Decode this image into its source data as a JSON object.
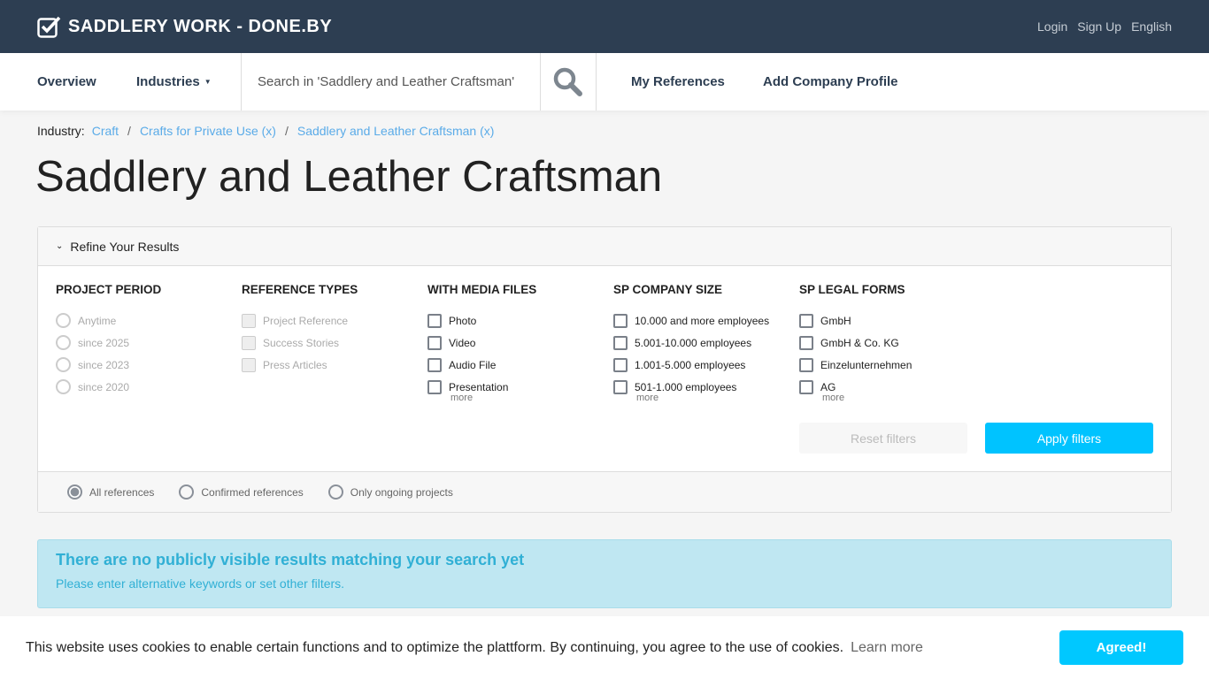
{
  "header": {
    "brand": "SADDLERY WORK - DONE.BY",
    "links": [
      "Login",
      "Sign Up",
      "English"
    ]
  },
  "nav": {
    "overview": "Overview",
    "industries": "Industries",
    "search_placeholder": "Search in 'Saddlery and Leather Craftsman'",
    "my_references": "My References",
    "add_company": "Add Company Profile"
  },
  "breadcrumb": {
    "label": "Industry:",
    "items": [
      "Craft",
      "Crafts for Private Use (x)",
      "Saddlery and Leather Craftsman (x)"
    ]
  },
  "title": "Saddlery and Leather Craftsman",
  "filters": {
    "toggle": "Refine Your Results",
    "columns": [
      {
        "title": "PROJECT PERIOD",
        "type": "radio",
        "disabled": true,
        "items": [
          "Anytime",
          "since 2025",
          "since 2023",
          "since 2020"
        ]
      },
      {
        "title": "REFERENCE TYPES",
        "type": "check",
        "disabled": true,
        "items": [
          "Project Reference",
          "Success Stories",
          "Press Articles"
        ]
      },
      {
        "title": "WITH MEDIA FILES",
        "type": "check",
        "items": [
          "Photo",
          "Video",
          "Audio File",
          "Presentation"
        ],
        "more": "more"
      },
      {
        "title": "SP COMPANY SIZE",
        "type": "check",
        "items": [
          "10.000 and more employees",
          "5.001-10.000 employees",
          "1.001-5.000 employees",
          "501-1.000 employees"
        ],
        "more": "more"
      },
      {
        "title": "SP LEGAL FORMS",
        "type": "check",
        "items": [
          "GmbH",
          "GmbH & Co. KG",
          "Einzelunternehmen",
          "AG"
        ],
        "more": "more"
      }
    ],
    "reset": "Reset filters",
    "apply": "Apply filters",
    "scope": [
      "All references",
      "Confirmed references",
      "Only ongoing projects"
    ],
    "scope_selected": 0
  },
  "alert": {
    "title": "There are no publicly visible results matching your search yet",
    "text": "Please enter alternative keywords or set other filters."
  },
  "cookie": {
    "text": "This website uses cookies to enable certain functions and to optimize the plattform. By continuing, you agree to the use of cookies.",
    "learn": "Learn more",
    "agree": "Agreed!"
  }
}
